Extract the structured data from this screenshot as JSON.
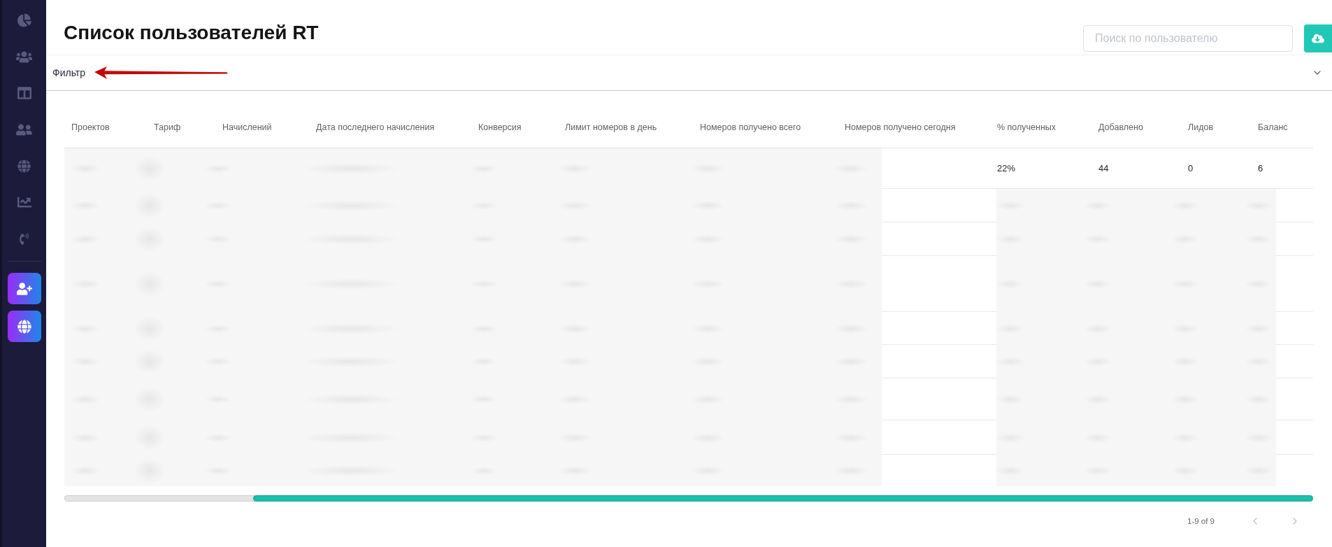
{
  "header": {
    "title": "Список пользователей RT",
    "search": {
      "placeholder": "Поиск по пользователю"
    }
  },
  "sidebar": {
    "items": [
      {
        "selected": false
      },
      {
        "selected": false
      },
      {
        "selected": false
      },
      {
        "selected": false
      },
      {
        "selected": false
      },
      {
        "selected": false
      },
      {
        "selected": false
      }
    ]
  },
  "filter": {
    "label": "Фильтр",
    "expanded": false
  },
  "table": {
    "columns": [
      "Проектов",
      "Тариф",
      "Начислений",
      "Дата последнего начисления",
      "Конверсия",
      "Лимит номеров в день",
      "Номеров получено всего",
      "Номеров получено сегодня",
      "% полученных",
      "Добавлено",
      "Лидов",
      "Баланс"
    ],
    "rows": [
      {
        "blurred": true,
        "cells": [
          "22%",
          "44",
          "0",
          "6"
        ]
      },
      {
        "blurred": true
      },
      {
        "blurred": true
      },
      {
        "blurred": true
      },
      {
        "blurred": true
      },
      {
        "blurred": true
      },
      {
        "blurred": true
      },
      {
        "blurred": true
      },
      {
        "blurred": true
      }
    ]
  },
  "pagination": {
    "range": "1-9 of 9",
    "previous": {
      "disabled": true
    },
    "next": {
      "disabled": true
    }
  }
}
